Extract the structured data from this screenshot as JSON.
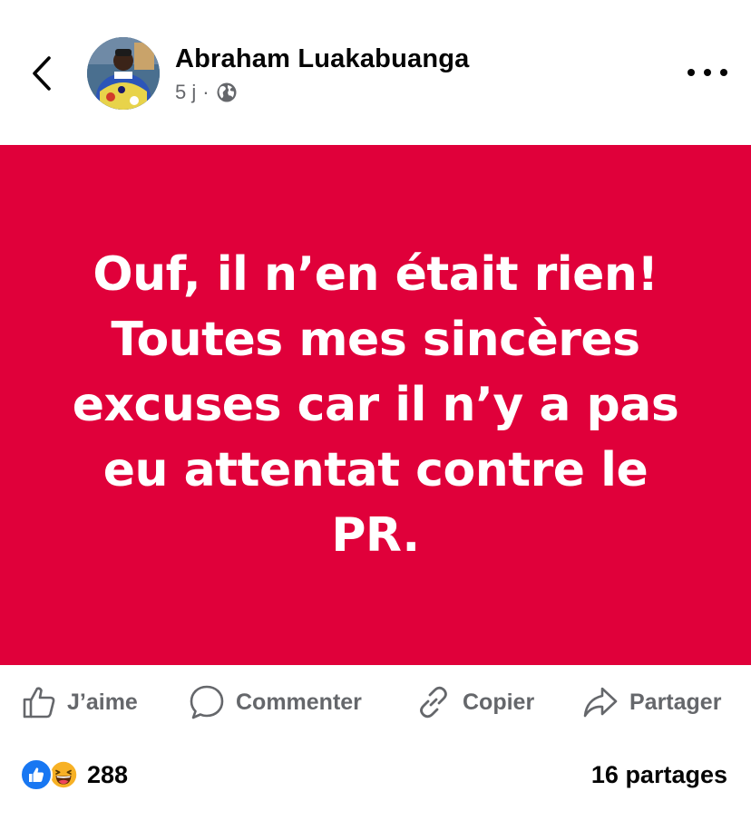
{
  "header": {
    "author_name": "Abraham Luakabuanga",
    "time_ago": "5 j",
    "separator": "·",
    "privacy_icon": "globe-icon",
    "back_icon": "chevron-left-icon",
    "more_icon": "more-horizontal-icon"
  },
  "post": {
    "text": "Ouf, il n’en était rien! Toutes mes sincères excuses car il n’y a pas eu attentat contre le PR.",
    "background_color": "#e0003a",
    "text_color": "#ffffff"
  },
  "actions": [
    {
      "label": "J’aime",
      "icon": "thumbs-up-icon"
    },
    {
      "label": "Commenter",
      "icon": "comment-icon"
    },
    {
      "label": "Copier",
      "icon": "link-icon"
    },
    {
      "label": "Partager",
      "icon": "share-icon"
    }
  ],
  "stats": {
    "reaction_icons": [
      "like-reaction-icon",
      "haha-reaction-icon"
    ],
    "reaction_count": "288",
    "shares": "16 partages"
  },
  "colors": {
    "accent": "#1877f2",
    "secondary_text": "#65676b",
    "primary_text": "#050505"
  }
}
